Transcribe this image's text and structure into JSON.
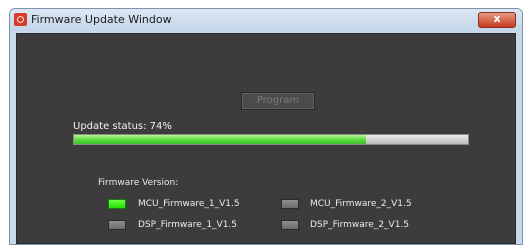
{
  "window": {
    "title": "Firmware Update Window",
    "close_glyph": "x"
  },
  "program_button": {
    "label": "Program"
  },
  "update_status": {
    "label": "Update status: 74%",
    "progress": 0.74
  },
  "firmware": {
    "section_label": "Firmware Version:",
    "items": [
      {
        "name": "MCU_Firmware_1_V1.5",
        "active": true
      },
      {
        "name": "MCU_Firmware_2_V1.5",
        "active": false
      },
      {
        "name": "DSP_Firmware_1_V1.5",
        "active": false
      },
      {
        "name": "DSP_Firmware_2_V1.5",
        "active": false
      }
    ]
  },
  "colors": {
    "led_on": "#20e000",
    "led_off": "#7a7a7a",
    "progress_fill": "#55d93a",
    "panel": "#3c3c3c"
  },
  "icons": {
    "app": "app-logo-icon",
    "close": "close-icon"
  }
}
